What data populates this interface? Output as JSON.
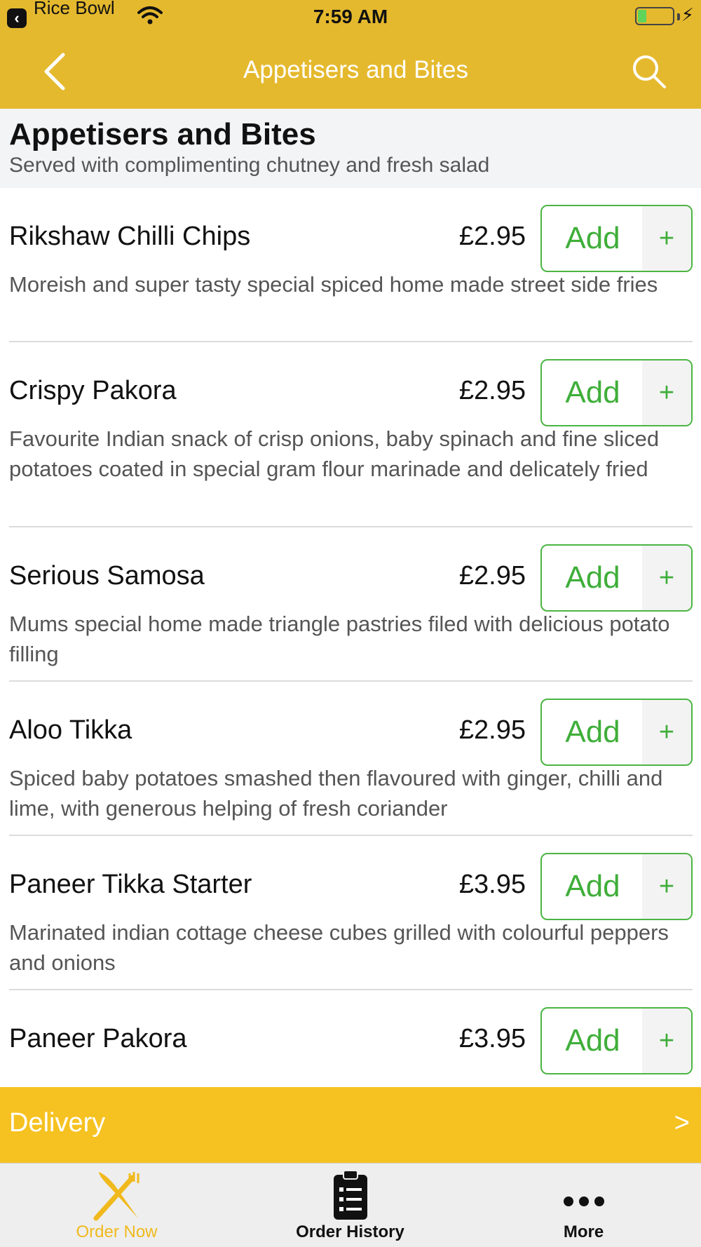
{
  "status_bar": {
    "back_app_label": "Rice Bowl",
    "time": "7:59 AM"
  },
  "nav": {
    "title": "Appetisers and Bites"
  },
  "section": {
    "title": "Appetisers and Bites",
    "subtitle": "Served with complimenting chutney and fresh salad"
  },
  "add_label": "Add",
  "add_plus": "+",
  "items": [
    {
      "name": "Rikshaw Chilli Chips",
      "price": "£2.95",
      "description": "Moreish and super tasty special spiced home made street side fries"
    },
    {
      "name": "Crispy Pakora",
      "price": "£2.95",
      "description": "Favourite Indian snack of crisp onions, baby spinach and fine sliced potatoes coated in special gram flour marinade and delicately fried"
    },
    {
      "name": "Serious Samosa",
      "price": "£2.95",
      "description": "Mums special home made triangle pastries filed with delicious potato filling"
    },
    {
      "name": "Aloo Tikka",
      "price": "£2.95",
      "description": "Spiced baby potatoes smashed then flavoured with ginger, chilli and lime, with generous helping of fresh coriander"
    },
    {
      "name": "Paneer Tikka Starter",
      "price": "£3.95",
      "description": "Marinated indian cottage cheese cubes grilled with colourful peppers and onions"
    },
    {
      "name": "Paneer Pakora",
      "price": "£3.95",
      "description": ""
    }
  ],
  "delivery": {
    "label": "Delivery",
    "arrow": ">"
  },
  "tabs": [
    {
      "label": "Order Now",
      "icon": "fork-knife-icon",
      "active": true
    },
    {
      "label": "Order History",
      "icon": "clipboard-list-icon",
      "active": false
    },
    {
      "label": "More",
      "icon": "more-dots-icon",
      "active": false
    }
  ],
  "colors": {
    "header": "#e5b92e",
    "delivery": "#f6c221",
    "accent_green": "#3fae3a",
    "tab_active": "#f0b91c"
  }
}
